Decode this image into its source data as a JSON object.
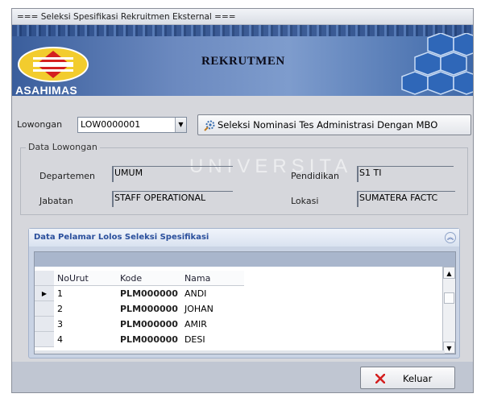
{
  "window": {
    "title": "=== Seleksi Spesifikasi Rekruitmen Eksternal ==="
  },
  "banner": {
    "brand": "ASAHIMAS",
    "title": "REKRUTMEN"
  },
  "lowongan": {
    "label": "Lowongan",
    "value": "LOW0000001"
  },
  "select_button": {
    "label": "Seleksi Nominasi Tes Administrasi Dengan MBO"
  },
  "data_lowongan": {
    "title": "Data Lowongan",
    "departemen_label": "Departemen",
    "departemen_value": "UMUM",
    "jabatan_label": "Jabatan",
    "jabatan_value": "STAFF OPERATIONAL",
    "pendidikan_label": "Pendidikan",
    "pendidikan_value": "S1 TI",
    "lokasi_label": "Lokasi",
    "lokasi_value": "SUMATERA FACTC"
  },
  "watermark": "UNIVERSITA",
  "panel": {
    "title": "Data Pelamar Lolos Seleksi Spesifikasi"
  },
  "grid": {
    "columns": [
      "NoUrut",
      "Kode",
      "Nama"
    ],
    "rows": [
      {
        "no": "1",
        "kode": "PLM000000",
        "nama": "ANDI"
      },
      {
        "no": "2",
        "kode": "PLM000000",
        "nama": "JOHAN"
      },
      {
        "no": "3",
        "kode": "PLM000000",
        "nama": "AMIR"
      },
      {
        "no": "4",
        "kode": "PLM000000",
        "nama": "DESI"
      }
    ]
  },
  "keluar_button": {
    "label": "Keluar"
  },
  "colors": {
    "accent": "#2a4f9c",
    "close_icon": "#d42020"
  }
}
